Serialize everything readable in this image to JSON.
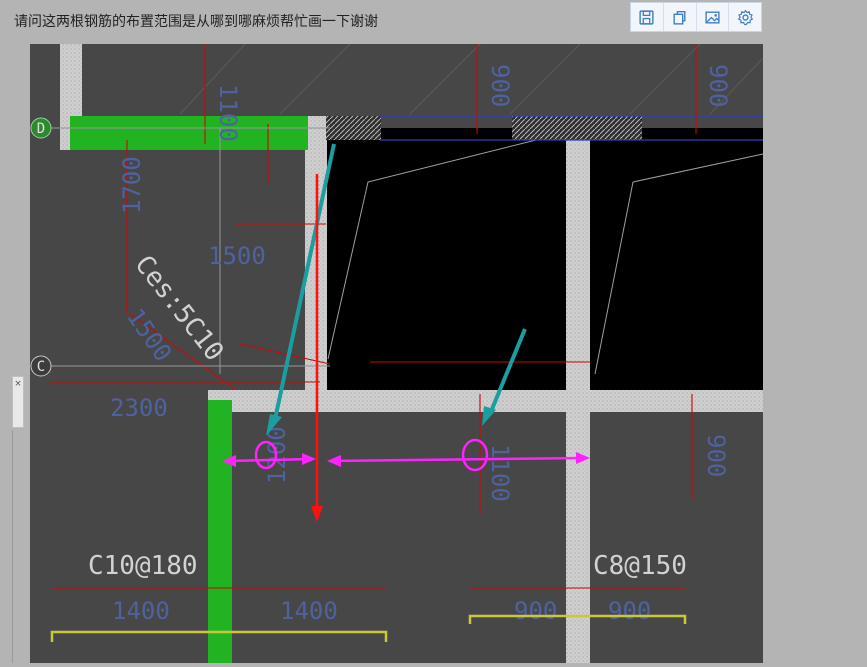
{
  "question": "请问这两根钢筋的布置范围是从哪到哪麻烦帮忙画一下谢谢",
  "toolbar": {
    "items": [
      {
        "icon": "save-icon",
        "tooltip": ""
      },
      {
        "icon": "copy-icon",
        "tooltip": ""
      },
      {
        "icon": "image-icon",
        "tooltip": ""
      },
      {
        "icon": "settings-icon",
        "tooltip": ""
      }
    ],
    "accent": "#3d7fc4"
  },
  "drawing": {
    "grid_labels": {
      "d": "D",
      "c": "C"
    },
    "dims": {
      "top_1100": "1100",
      "top_900_a": "900",
      "top_900_b": "900",
      "left_1700": "1700",
      "mid_1500": "1500",
      "diag_1500": "1500",
      "left_2300": "2300",
      "mid_1200": "1200",
      "mid_1100": "1100",
      "right_900": "900",
      "bottom_1400_a": "1400",
      "bottom_1400_b": "1400",
      "bottom_900_a": "900",
      "bottom_900_b": "900"
    },
    "rebar_labels": {
      "ces": "Ces:5C10",
      "left": "C10@180",
      "right": "C8@150"
    },
    "colors": {
      "background": "#474747",
      "wall": "#cdcdcd",
      "green_beam": "#22b322",
      "annotation_magenta": "#ff22ff",
      "annotation_red": "#ff1010",
      "annotation_teal": "#1a9ea0",
      "dim_red": "#c80a0a",
      "dim_text": "#4f62a0",
      "rebar_text": "#d2d2d2",
      "yellow_bracket": "#c8c83c"
    }
  }
}
